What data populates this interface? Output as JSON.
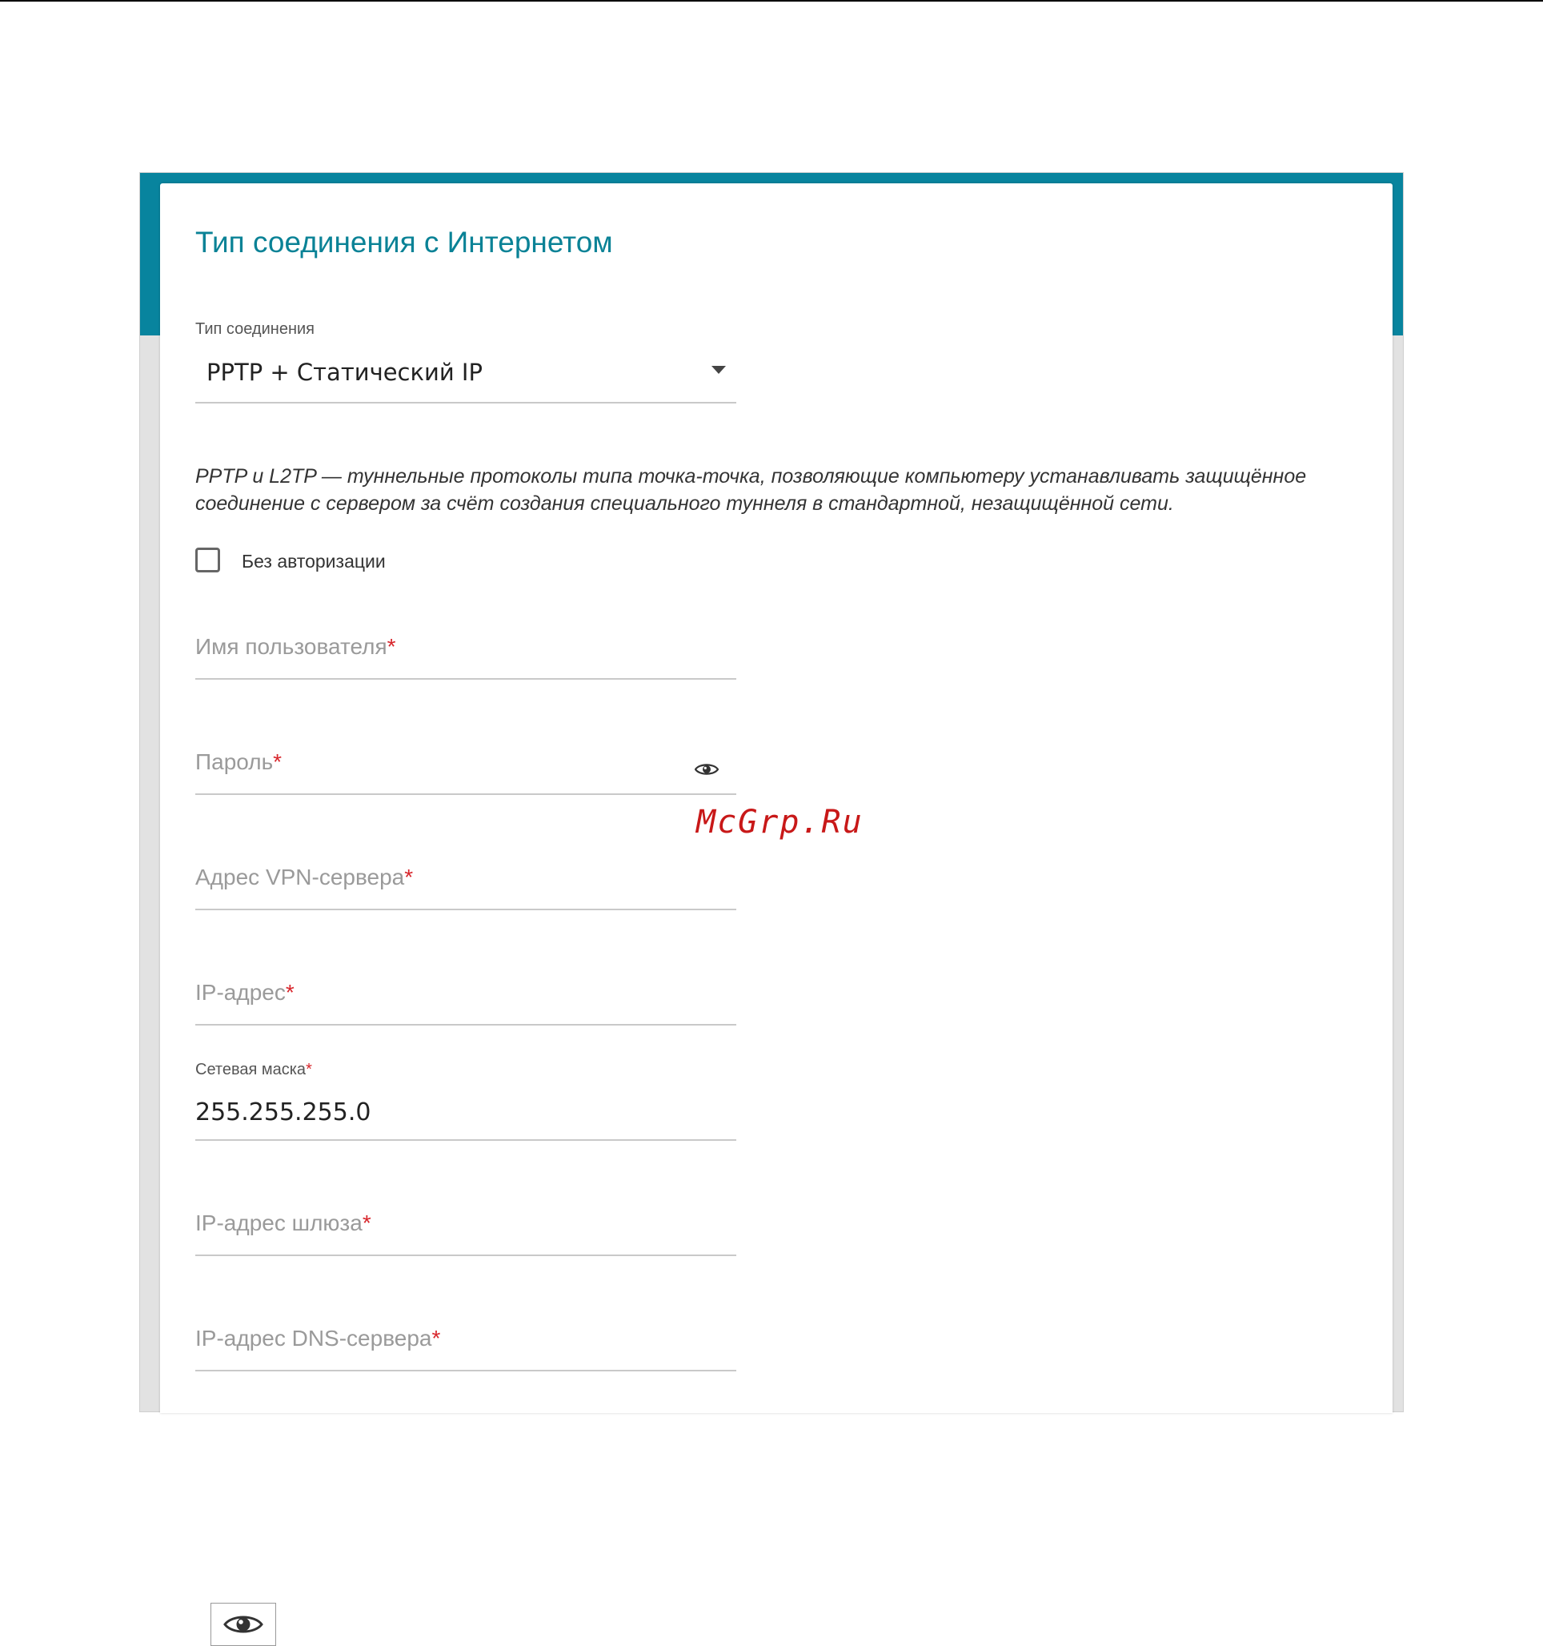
{
  "page": {
    "title": "Тип соединения с Интернетом"
  },
  "connection_type": {
    "label": "Тип соединения",
    "value": "PPTP + Статический IP"
  },
  "description": "PPTP и L2TP — туннельные протоколы типа точка-точка, позволяющие компьютеру устанавливать защищённое соединение с сервером за счёт создания специального туннеля в стандартной, незащищённой сети.",
  "no_auth": {
    "label": "Без авторизации",
    "checked": false
  },
  "fields": {
    "username": {
      "label": "Имя пользователя",
      "required_mark": "*"
    },
    "password": {
      "label": "Пароль",
      "required_mark": "*",
      "icon": "eye-icon"
    },
    "vpn_server": {
      "label": "Адрес VPN-сервера",
      "required_mark": "*"
    },
    "ip_address": {
      "label": "IP-адрес",
      "required_mark": "*"
    },
    "netmask": {
      "label": "Сетевая маска",
      "required_mark": "*",
      "value": "255.255.255.0"
    },
    "gateway": {
      "label": "IP-адрес шлюза",
      "required_mark": "*"
    },
    "dns": {
      "label": "IP-адрес DNS-сервера",
      "required_mark": "*"
    }
  },
  "watermark": "McGrp.Ru",
  "colors": {
    "accent": "#08849e",
    "title": "#0a8296",
    "required": "#d8262c"
  },
  "bottom_icon": "eye-icon"
}
